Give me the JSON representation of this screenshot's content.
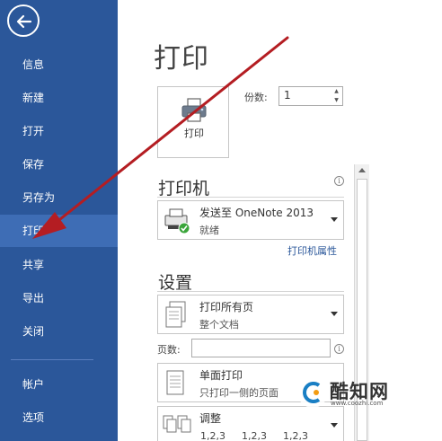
{
  "sidebar": {
    "items": [
      {
        "label": "信息"
      },
      {
        "label": "新建"
      },
      {
        "label": "打开"
      },
      {
        "label": "保存"
      },
      {
        "label": "另存为"
      },
      {
        "label": "打印"
      },
      {
        "label": "共享"
      },
      {
        "label": "导出"
      },
      {
        "label": "关闭"
      },
      {
        "label": "帐户"
      },
      {
        "label": "选项"
      }
    ],
    "active": "打印"
  },
  "main": {
    "title": "打印",
    "print_button_label": "打印",
    "copies_label": "份数:",
    "copies_value": "1",
    "printer_section": {
      "title": "打印机",
      "name": "发送至 OneNote 2013",
      "status": "就绪",
      "properties_link": "打印机属性"
    },
    "settings_section": {
      "title": "设置",
      "range_main": "打印所有页",
      "range_sub": "整个文档",
      "pages_label": "页数:",
      "sides_main": "单面打印",
      "sides_sub": "只打印一侧的页面",
      "collate_main": "调整",
      "collate_sub": [
        "1,2,3",
        "1,2,3",
        "1,2,3"
      ]
    }
  },
  "watermark": {
    "brand": "酷知网",
    "url": "www.coozhi.com"
  },
  "colors": {
    "sidebar": "#2b579a",
    "sidebar_active": "#3e6db5",
    "arrow": "#b41d22",
    "link": "#2b579a"
  }
}
